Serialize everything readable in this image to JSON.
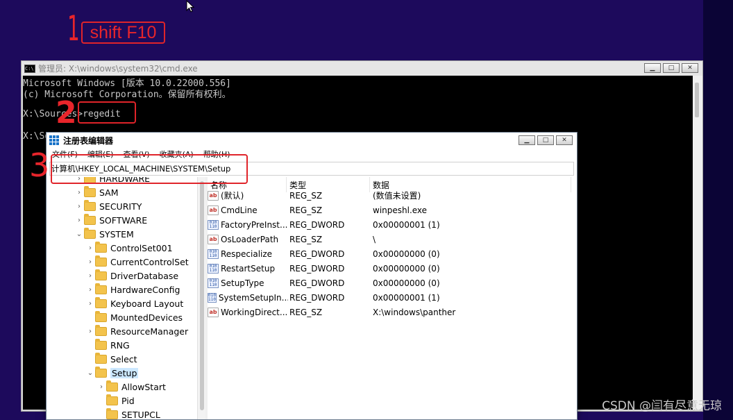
{
  "annotations": {
    "step1_num": "1",
    "step1_text": "shift F10",
    "step2_num": "2",
    "step3_num": "3"
  },
  "cmd": {
    "title": "管理员: X:\\windows\\system32\\cmd.exe",
    "lines": [
      "Microsoft Windows [版本 10.0.22000.556]",
      "(c) Microsoft Corporation。保留所有权利。",
      "",
      "X:\\Sources>regedit",
      "",
      "X:\\So"
    ]
  },
  "regedit": {
    "title": "注册表编辑器",
    "menu": [
      "文件(F)",
      "编辑(E)",
      "查看(V)",
      "收藏夹(A)",
      "帮助(H)"
    ],
    "address": "计算机\\HKEY_LOCAL_MACHINE\\SYSTEM\\Setup",
    "tree": [
      {
        "label": "HARDWARE",
        "level": 0,
        "chevron": "right"
      },
      {
        "label": "SAM",
        "level": 0,
        "chevron": "right"
      },
      {
        "label": "SECURITY",
        "level": 0,
        "chevron": "right"
      },
      {
        "label": "SOFTWARE",
        "level": 0,
        "chevron": "right"
      },
      {
        "label": "SYSTEM",
        "level": 0,
        "chevron": "down"
      },
      {
        "label": "ControlSet001",
        "level": 1,
        "chevron": "right"
      },
      {
        "label": "CurrentControlSet",
        "level": 1,
        "chevron": "right"
      },
      {
        "label": "DriverDatabase",
        "level": 1,
        "chevron": "right"
      },
      {
        "label": "HardwareConfig",
        "level": 1,
        "chevron": "right"
      },
      {
        "label": "Keyboard Layout",
        "level": 1,
        "chevron": "right"
      },
      {
        "label": "MountedDevices",
        "level": 1,
        "chevron": ""
      },
      {
        "label": "ResourceManager",
        "level": 1,
        "chevron": "right"
      },
      {
        "label": "RNG",
        "level": 1,
        "chevron": ""
      },
      {
        "label": "Select",
        "level": 1,
        "chevron": ""
      },
      {
        "label": "Setup",
        "level": 1,
        "chevron": "down",
        "selected": true
      },
      {
        "label": "AllowStart",
        "level": 2,
        "chevron": "right"
      },
      {
        "label": "Pid",
        "level": 2,
        "chevron": ""
      },
      {
        "label": "SETUPCL",
        "level": 2,
        "chevron": ""
      }
    ],
    "columns": [
      "名称",
      "类型",
      "数据"
    ],
    "values": [
      {
        "icon": "ab",
        "name": "(默认)",
        "type": "REG_SZ",
        "data": "(数值未设置)"
      },
      {
        "icon": "ab",
        "name": "CmdLine",
        "type": "REG_SZ",
        "data": "winpeshl.exe"
      },
      {
        "icon": "bin",
        "name": "FactoryPreInst...",
        "type": "REG_DWORD",
        "data": "0x00000001 (1)"
      },
      {
        "icon": "ab",
        "name": "OsLoaderPath",
        "type": "REG_SZ",
        "data": "\\"
      },
      {
        "icon": "bin",
        "name": "Respecialize",
        "type": "REG_DWORD",
        "data": "0x00000000 (0)"
      },
      {
        "icon": "bin",
        "name": "RestartSetup",
        "type": "REG_DWORD",
        "data": "0x00000000 (0)"
      },
      {
        "icon": "bin",
        "name": "SetupType",
        "type": "REG_DWORD",
        "data": "0x00000000 (0)"
      },
      {
        "icon": "bin",
        "name": "SystemSetupIn...",
        "type": "REG_DWORD",
        "data": "0x00000001 (1)"
      },
      {
        "icon": "ab",
        "name": "WorkingDirect...",
        "type": "REG_SZ",
        "data": "X:\\windows\\panther"
      }
    ]
  },
  "watermark": "CSDN @闫有尽意无琼",
  "colors": {
    "annotation_red": "#e8252b",
    "desktop_bg": "#1d0a5c",
    "selection": "#cce8ff"
  }
}
